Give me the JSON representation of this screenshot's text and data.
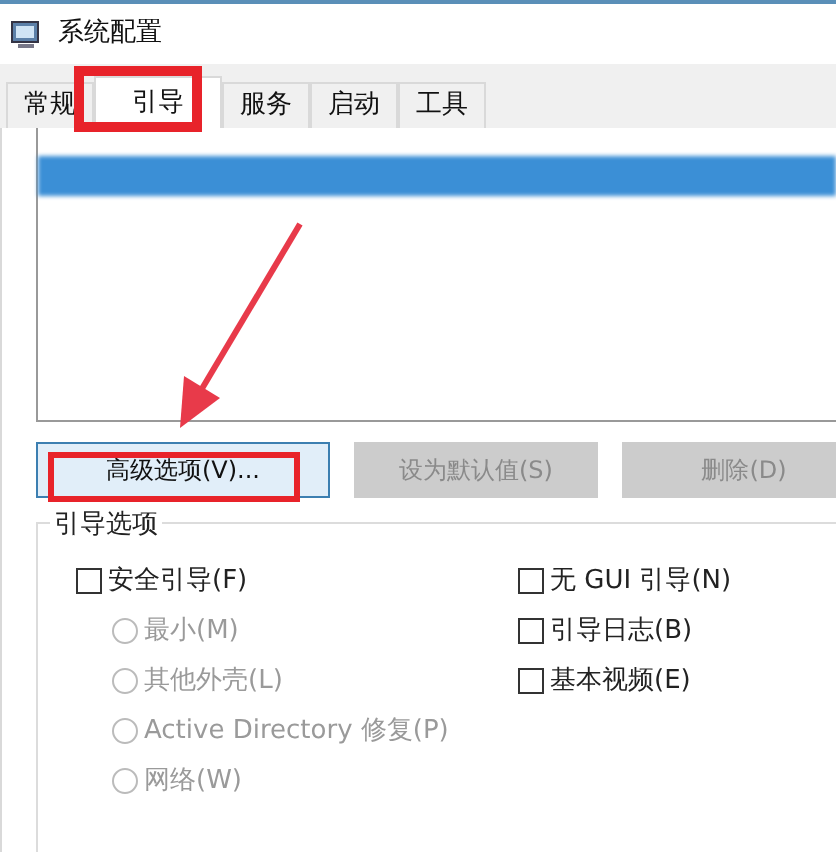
{
  "window": {
    "title": "系统配置"
  },
  "tabs": [
    {
      "label": "常规",
      "selected": false
    },
    {
      "label": "引导",
      "selected": true
    },
    {
      "label": "服务",
      "selected": false
    },
    {
      "label": "启动",
      "selected": false
    },
    {
      "label": "工具",
      "selected": false
    }
  ],
  "boot_list": {
    "items": [
      {
        "selected": true
      }
    ]
  },
  "buttons": [
    {
      "label": "高级选项(V)...",
      "disabled": false
    },
    {
      "label": "设为默认值(S)",
      "disabled": true
    },
    {
      "label": "删除(D)",
      "disabled": true
    }
  ],
  "boot_options": {
    "title": "引导选项",
    "left": [
      {
        "kind": "checkbox",
        "label": "安全引导(F)",
        "checked": false,
        "disabled": false
      },
      {
        "kind": "radio",
        "label": "最小(M)",
        "selected": false,
        "disabled": true
      },
      {
        "kind": "radio",
        "label": "其他外壳(L)",
        "selected": false,
        "disabled": true
      },
      {
        "kind": "radio",
        "label": "Active Directory 修复(P)",
        "selected": false,
        "disabled": true
      },
      {
        "kind": "radio",
        "label": "网络(W)",
        "selected": false,
        "disabled": true
      }
    ],
    "right": [
      {
        "kind": "checkbox",
        "label": "无 GUI 引导(N)",
        "checked": false,
        "disabled": false
      },
      {
        "kind": "checkbox",
        "label": "引导日志(B)",
        "checked": false,
        "disabled": false
      },
      {
        "kind": "checkbox",
        "label": "基本视频(E)",
        "checked": false,
        "disabled": false
      }
    ]
  }
}
